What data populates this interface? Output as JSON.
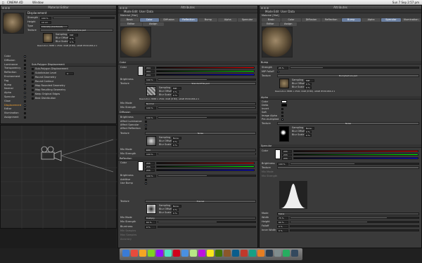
{
  "menubar": {
    "app": "CINEMA 4D",
    "items": [
      "Window"
    ],
    "clock": "Sun 7 Sep  2:57 pm"
  },
  "material_editor": {
    "title": "Material Editor",
    "section": "Displacement",
    "params": [
      {
        "label": "Strength",
        "value": "100 %"
      },
      {
        "label": "Height",
        "value": "10 cm"
      },
      {
        "label": "Type",
        "value": "Intensity (Centered)"
      }
    ],
    "texture": {
      "label": "Texture",
      "file": "Bumptexture.psd",
      "sampling_label": "Sampling",
      "sampling": "MIP",
      "blur_offset_label": "Blur Offset",
      "blur_offset": "0 %",
      "blur_scale_label": "Blur Scale",
      "blur_scale": "0 %",
      "resolution": "Resolution 3888 x 2592, RGB (8 Bit), sRGB IEC61966-2.1"
    },
    "channels": [
      {
        "label": "Color",
        "on": true
      },
      {
        "label": "Diffusion",
        "on": false
      },
      {
        "label": "Luminance",
        "on": false
      },
      {
        "label": "Transparency",
        "on": false
      },
      {
        "label": "Reflection",
        "on": true
      },
      {
        "label": "Environment",
        "on": false
      },
      {
        "label": "Fog",
        "on": false
      },
      {
        "label": "Bump",
        "on": true
      },
      {
        "label": "Normal",
        "on": false
      },
      {
        "label": "Alpha",
        "on": true
      },
      {
        "label": "Specular",
        "on": true
      },
      {
        "label": "Glow",
        "on": false
      },
      {
        "label": "Displacement",
        "on": true
      },
      {
        "label": "Editor",
        "on": false
      },
      {
        "label": "Illumination",
        "on": false
      },
      {
        "label": "Assignment",
        "on": false
      }
    ],
    "subpoly": {
      "header": "Sub-Polygon Displacement",
      "items": [
        {
          "label": "Sub-Polygon Displacement"
        },
        {
          "label": "Subdivision Level",
          "value": "4"
        },
        {
          "label": "Round Geometry"
        },
        {
          "label": "Round Contour"
        },
        {
          "label": "Map Rounded Geometry"
        },
        {
          "label": "Map Resulting Geometry"
        },
        {
          "label": "Keep Original Edges"
        },
        {
          "label": "Best Distribution"
        }
      ]
    }
  },
  "attr_mid": {
    "title": "Attributes",
    "menu": [
      "Mode",
      "Edit",
      "User Data"
    ],
    "material": "Material [Mat]",
    "tabs": [
      "Basic",
      "Color",
      "Diffusion",
      "Reflection",
      "Bump",
      "Alpha",
      "Specular",
      "Editor",
      "Assign"
    ],
    "color_section": "Color",
    "color": {
      "label": "Color",
      "r": "204",
      "g": "204",
      "b": "204",
      "brightness_label": "Brightness",
      "brightness": "100 %",
      "texture_label": "Texture",
      "texture_file": "StandardTile.psd",
      "sampling_label": "Sampling",
      "sampling": "MIP",
      "blur_offset_label": "Blur Offset",
      "blur_offset": "0 %",
      "blur_scale_label": "Blur Scale",
      "blur_scale": "0 %",
      "resolution": "Resolution 3888 x 2592, RGB (8 Bit), sRGB IEC61966-2.1",
      "mix_mode_label": "Mix Mode",
      "mix_mode": "Normal",
      "mix_strength_label": "Mix Strength",
      "mix_strength": "100 %"
    },
    "diffusion_section": "Diffusion",
    "diffusion": {
      "brightness_label": "Brightness",
      "brightness": "100 %",
      "affect_lum": "Affect Luminance",
      "affect_spec": "Affect Specular",
      "affect_refl": "Affect Reflection",
      "texture_label": "Texture",
      "texture": "Noise",
      "sampling_label": "Sampling",
      "sampling": "None",
      "blur_offset_label": "Blur Offset",
      "blur_offset": "0 %",
      "blur_scale_label": "Blur Scale",
      "blur_scale": "0 %",
      "mix_mode_label": "Mix Mode",
      "mix_mode": "Add",
      "mix_strength_label": "Mix Strength",
      "mix_strength": "100 %"
    },
    "reflection_section": "Reflection",
    "reflection": {
      "color_label": "Color",
      "r": "255",
      "g": "255",
      "b": "255",
      "brightness_label": "Brightness",
      "brightness": "100 %",
      "additive_label": "Additive",
      "use_bump_label": "Use Bump",
      "texture_label": "Texture",
      "texture": "Fresnel",
      "sampling_label": "Sampling",
      "sampling": "None",
      "blur_offset_label": "Blur Offset",
      "blur_offset": "0 %",
      "blur_scale_label": "Blur Scale",
      "blur_scale": "0 %",
      "mix_mode_label": "Mix Mode",
      "mix_mode": "Multiply",
      "mix_strength_label": "Mix Strength",
      "mix_strength": "60 %",
      "blurriness_label": "Blurriness",
      "blurriness": "0 %",
      "min_samples_label": "Min Samples",
      "max_samples_label": "Max Samples",
      "accuracy_label": "Accuracy"
    }
  },
  "attr_right": {
    "title": "Attributes",
    "menu": [
      "Mode",
      "Edit",
      "User Data"
    ],
    "material": "Material [Mat]",
    "tabs": [
      "Basic",
      "Color",
      "Diffusion",
      "Reflection",
      "Bump",
      "Alpha",
      "Specular",
      "Illumination",
      "Editor",
      "Assign"
    ],
    "bump_section": "Bump",
    "bump": {
      "strength_label": "Strength",
      "strength": "25 %",
      "mip_label": "MIP Falloff",
      "texture_label": "Texture",
      "texture_file": "Bumptexture.psd",
      "sampling_label": "Sampling",
      "sampling": "MIP",
      "blur_offset_label": "Blur Offset",
      "blur_offset": "0 %",
      "blur_scale_label": "Blur Scale",
      "blur_scale": "0 %",
      "resolution": "Resolution 3888 x 2592, RGB (8 Bit), sRGB IEC61966-2.1"
    },
    "alpha_section": "Alpha",
    "alpha": {
      "color_label": "Color",
      "delta_label": "Delta",
      "invert_label": "Invert",
      "soft_label": "Soft",
      "image_alpha_label": "Image Alpha",
      "premult_label": "Pre-multiplied",
      "texture_label": "Texture",
      "texture": "Noise",
      "sampling_label": "Sampling",
      "sampling": "None",
      "blur_offset_label": "Blur Offset",
      "blur_offset": "0 %",
      "blur_scale_label": "Blur Scale",
      "blur_scale": "0 %"
    },
    "specular_section": "Specular",
    "specular": {
      "color_label": "Color",
      "r": "255",
      "g": "255",
      "b": "255",
      "brightness_label": "Brightness",
      "brightness": "100 %",
      "texture_label": "Texture",
      "mix_mode_label": "Mix Mode",
      "mix_strength_label": "Mix Strength",
      "mode_label": "Mode",
      "mode": "Metal",
      "width_label": "Width",
      "width": "75 %",
      "height_label": "Height",
      "height": "60 %",
      "falloff_label": "Falloff",
      "falloff": "0 %",
      "inner_width_label": "Inner Width",
      "inner_width": "0 %"
    }
  },
  "viewport_label": "Material Editor",
  "colors": {
    "accent": "#6a7fa0",
    "panel": "#3a3a3a",
    "dark": "#202020"
  }
}
